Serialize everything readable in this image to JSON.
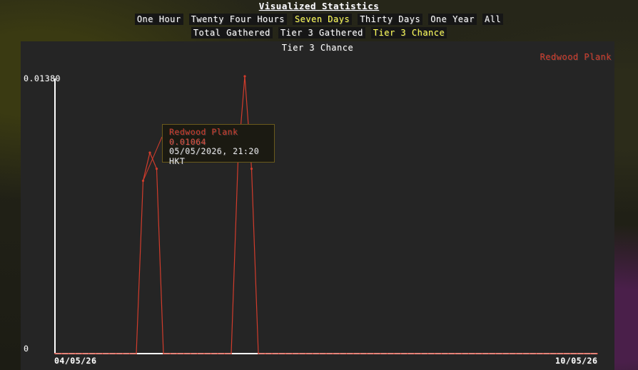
{
  "header": {
    "title": "Visualized Statistics"
  },
  "time_tabs": [
    {
      "label": "One Hour",
      "active": false
    },
    {
      "label": "Twenty Four Hours",
      "active": false
    },
    {
      "label": "Seven Days",
      "active": true
    },
    {
      "label": "Thirty Days",
      "active": false
    },
    {
      "label": "One Year",
      "active": false
    },
    {
      "label": "All",
      "active": false
    }
  ],
  "stat_tabs": [
    {
      "label": "Total Gathered",
      "active": false
    },
    {
      "label": "Tier 3 Gathered",
      "active": false
    },
    {
      "label": "Tier 3 Chance",
      "active": true
    }
  ],
  "colors": {
    "series": "#d23c2c",
    "active_tab": "#ffff55"
  },
  "tooltip": {
    "series": "Redwood Plank",
    "value": "0.01064",
    "time": "05/05/2026, 21:20 HKT"
  },
  "chart_data": {
    "type": "line",
    "title": "Tier 3 Chance",
    "ylim": [
      0,
      0.0138
    ],
    "y_tick_labels": [
      "0.01380",
      "0"
    ],
    "x_tick_labels": [
      "04/05/26",
      "10/05/26"
    ],
    "legend_position": "top-right",
    "grid": false,
    "series": [
      {
        "name": "Redwood Plank",
        "x": [
          0,
          0.25,
          0.5,
          0.75,
          1,
          1.25,
          1.5,
          1.75,
          2,
          2.25,
          2.5,
          2.75,
          3,
          3.25,
          3.5,
          3.75,
          4,
          4.25,
          4.5,
          4.75,
          5,
          5.25,
          5.5,
          5.75,
          6,
          6.25,
          6.5,
          6.75,
          7,
          7.25,
          7.5,
          7.75,
          8,
          8.25,
          8.5,
          8.75,
          9,
          9.25,
          9.5,
          9.75,
          10,
          10.25,
          10.5,
          10.75,
          11,
          11.25,
          11.5,
          11.75,
          12,
          12.25,
          12.5,
          12.75,
          13,
          13.25,
          13.5,
          13.75,
          14,
          14.25,
          14.5,
          14.75,
          15,
          15.25,
          15.5,
          15.75,
          16,
          16.25,
          16.5,
          16.75,
          17,
          17.25,
          17.5,
          17.75,
          18,
          18.25,
          18.5,
          18.75,
          19,
          19.25,
          19.5,
          19.75,
          20
        ],
        "values": [
          0,
          0,
          0,
          0,
          0,
          0,
          0,
          0,
          0,
          0,
          0,
          0,
          0,
          0.0086,
          0.01,
          0.0092,
          0,
          0,
          0,
          0,
          0,
          0,
          0,
          0,
          0,
          0,
          0,
          0.0096,
          0.0138,
          0.0092,
          0,
          0,
          0,
          0,
          0,
          0,
          0,
          0,
          0,
          0,
          0,
          0,
          0,
          0,
          0,
          0,
          0,
          0,
          0,
          0,
          0,
          0,
          0,
          0,
          0,
          0,
          0,
          0,
          0,
          0,
          0,
          0,
          0,
          0,
          0,
          0,
          0,
          0,
          0,
          0,
          0,
          0,
          0,
          0,
          0,
          0,
          0,
          0,
          0,
          0,
          0
        ]
      }
    ]
  }
}
